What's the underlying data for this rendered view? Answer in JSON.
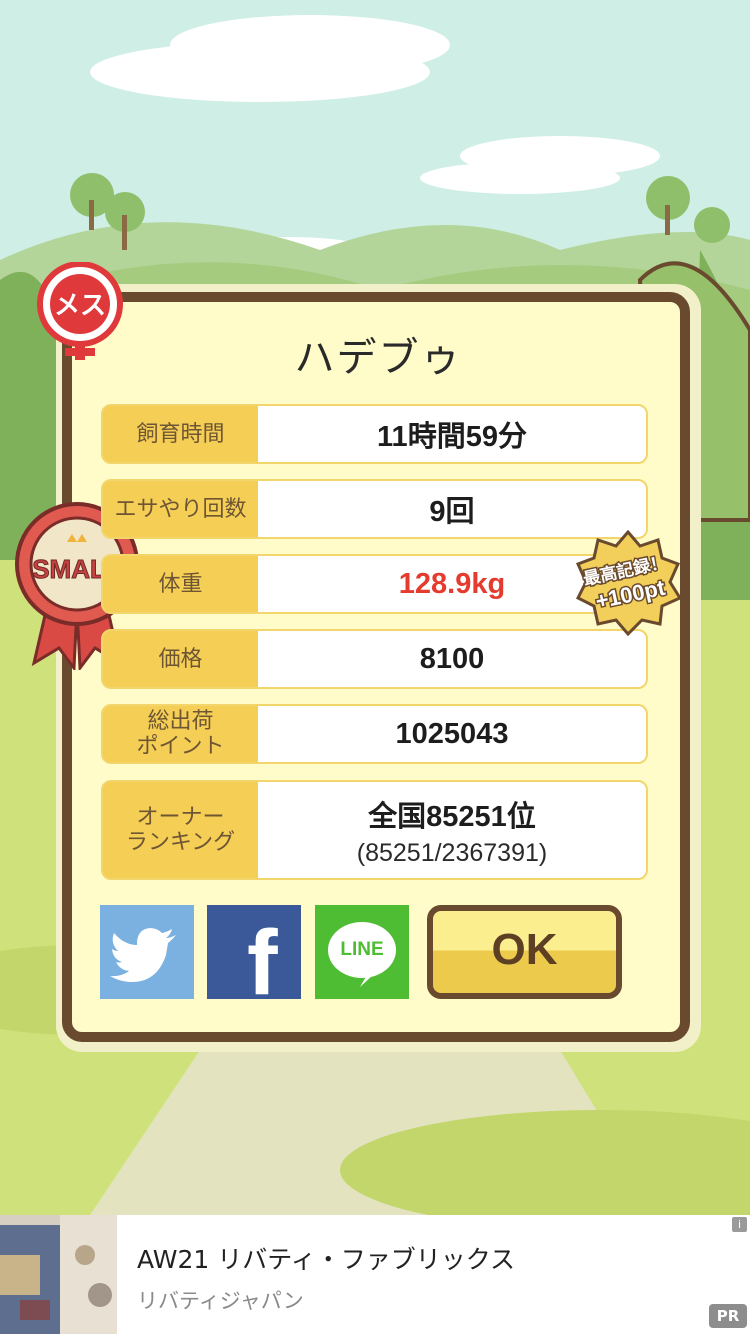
{
  "pet": {
    "name": "ハデブゥ",
    "gender_badge": "メス",
    "size_badge": "SMALL",
    "record_badge_line1": "最高記録！",
    "record_badge_line2": "+100pt"
  },
  "stats": [
    {
      "label": "飼育時間",
      "value": "11時間59分"
    },
    {
      "label": "エサやり回数",
      "value": "9回"
    },
    {
      "label": "体重",
      "value": "128.9kg"
    },
    {
      "label": "価格",
      "value": "8100"
    },
    {
      "label": "総出荷\nポイント",
      "value": "1025043"
    },
    {
      "label": "オーナー\nランキング",
      "value": "全国85251位",
      "sub": "(85251/2367391)"
    }
  ],
  "buttons": {
    "twitter_icon": "twitter-icon",
    "facebook_label": "f",
    "line_label": "LINE",
    "ok_label": "OK"
  },
  "ad": {
    "title": "AW21 リバティ・ファブリックス",
    "advertiser": "リバティジャパン",
    "info": "i",
    "pr": "PR"
  },
  "colors": {
    "frame_brown": "#6a4a2e",
    "panel_cream": "#fffcc9",
    "label_yellow": "#f5cf55",
    "weight_red": "#e53b2f",
    "twitter": "#7ab1e0",
    "facebook": "#3b5998",
    "line": "#4fbd33"
  }
}
